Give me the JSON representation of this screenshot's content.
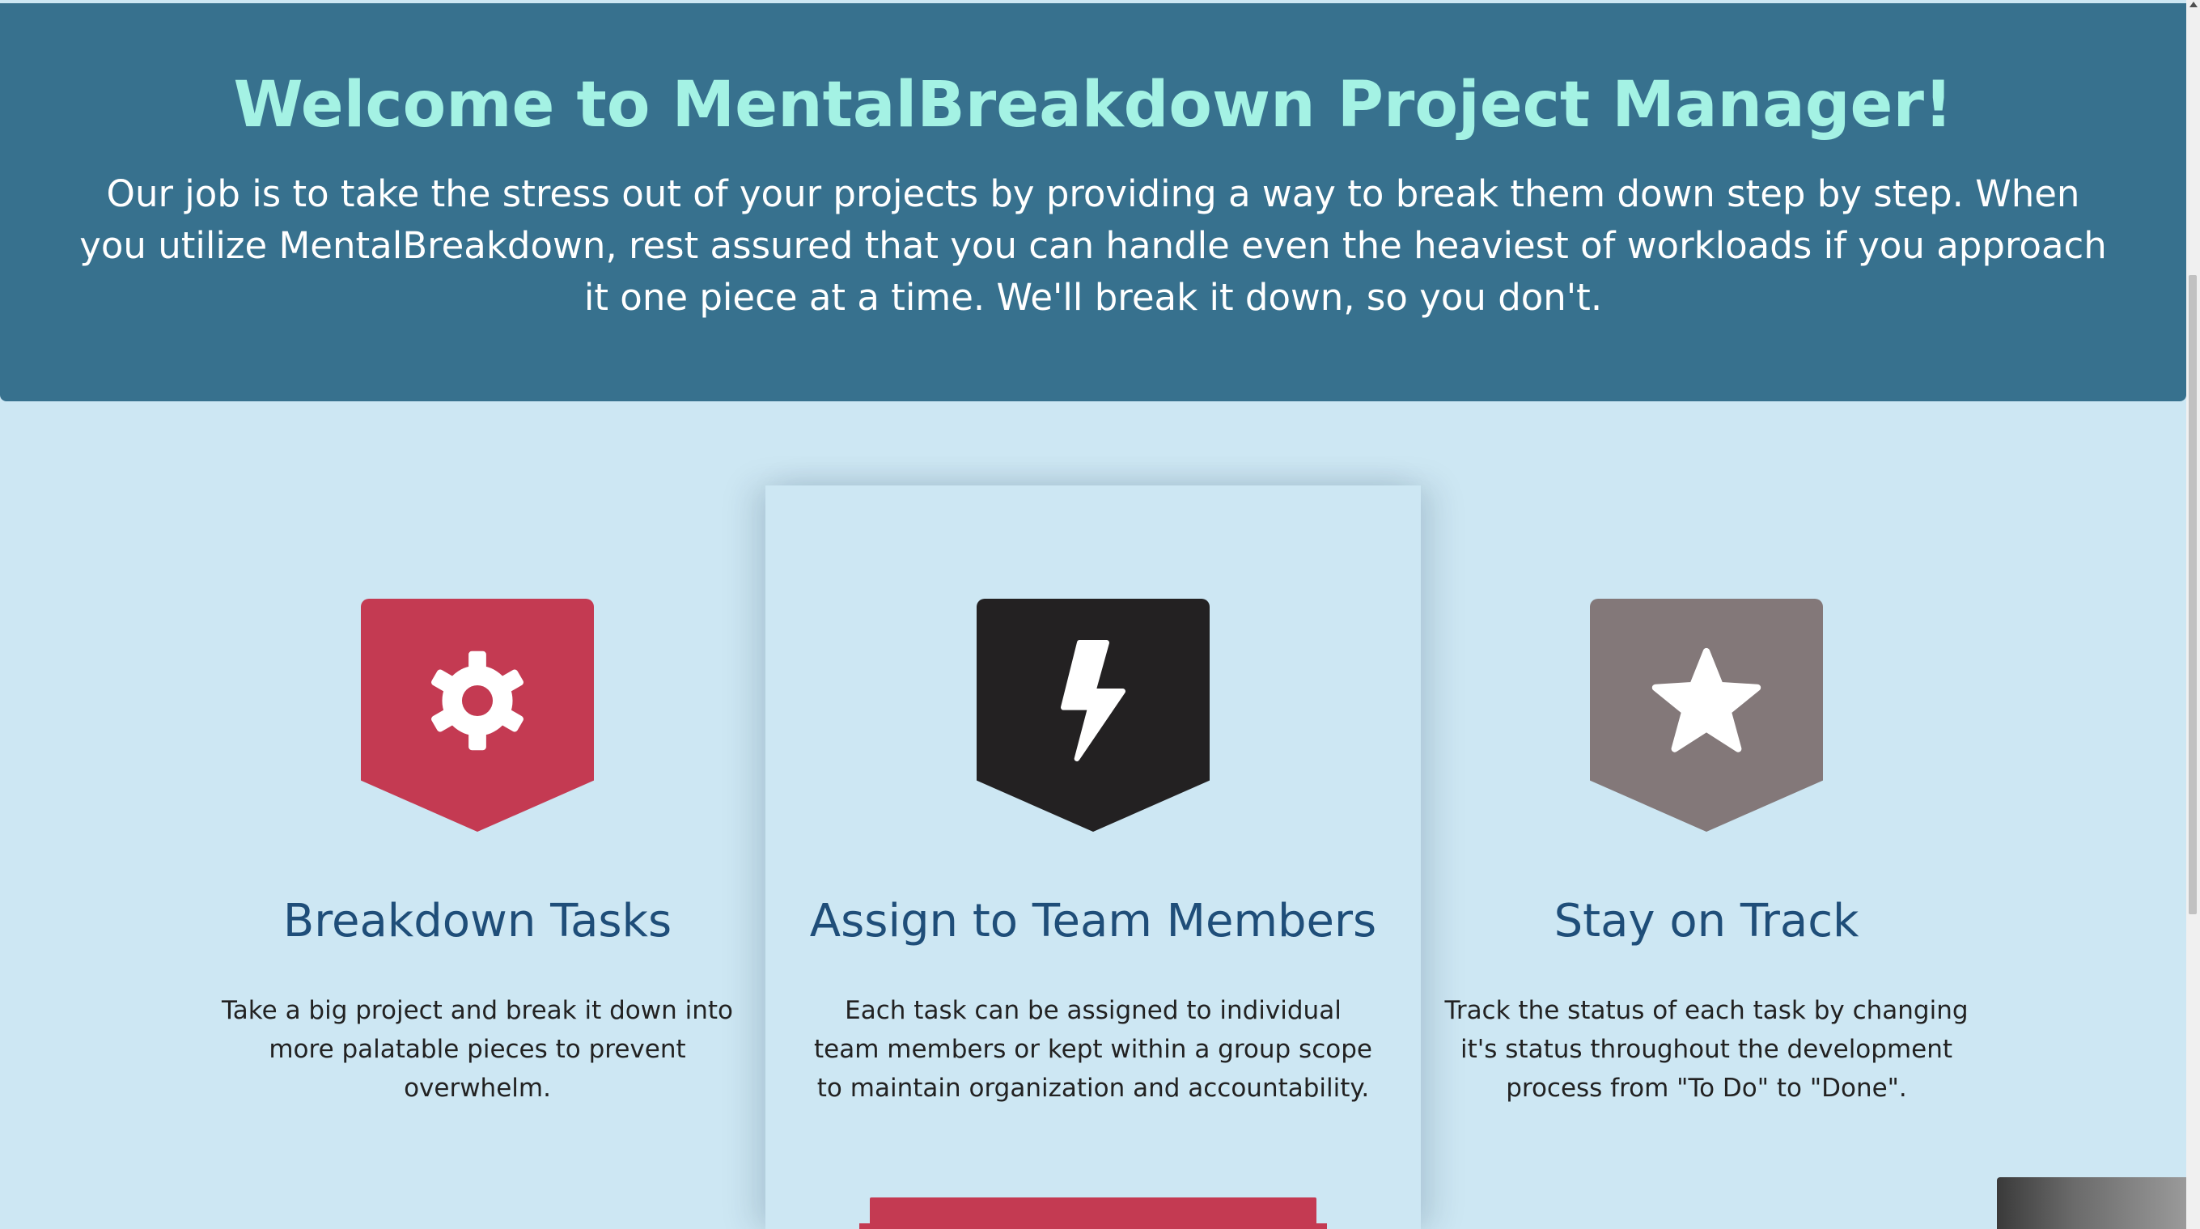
{
  "hero": {
    "title": "Welcome to MentalBreakdown Project Manager!",
    "description": "Our job is to take the stress out of your projects by providing a way to break them down step by step. When you utilize MentalBreakdown, rest assured that you can handle even the heaviest of workloads if you approach it one piece at a time. We'll break it down, so you don't."
  },
  "features": [
    {
      "icon": "gear-icon",
      "badge_color": "#c43a52",
      "title": "Breakdown Tasks",
      "description": "Take a big project and break it down into more palatable pieces to prevent overwhelm."
    },
    {
      "icon": "lightning-icon",
      "badge_color": "#232122",
      "title": "Assign to Team Members",
      "description": "Each task can be assigned to individual team members or kept within a group scope to maintain organization and accountability."
    },
    {
      "icon": "star-icon",
      "badge_color": "#837879",
      "title": "Stay on Track",
      "description": "Track the status of each task by changing it's status throughout the development process from \"To Do\" to \"Done\"."
    }
  ],
  "colors": {
    "hero_background": "#37718e",
    "hero_title": "#a4f2e4",
    "page_background": "#cde7f3",
    "feature_title": "#1f4e79",
    "accent": "#c43a52"
  }
}
